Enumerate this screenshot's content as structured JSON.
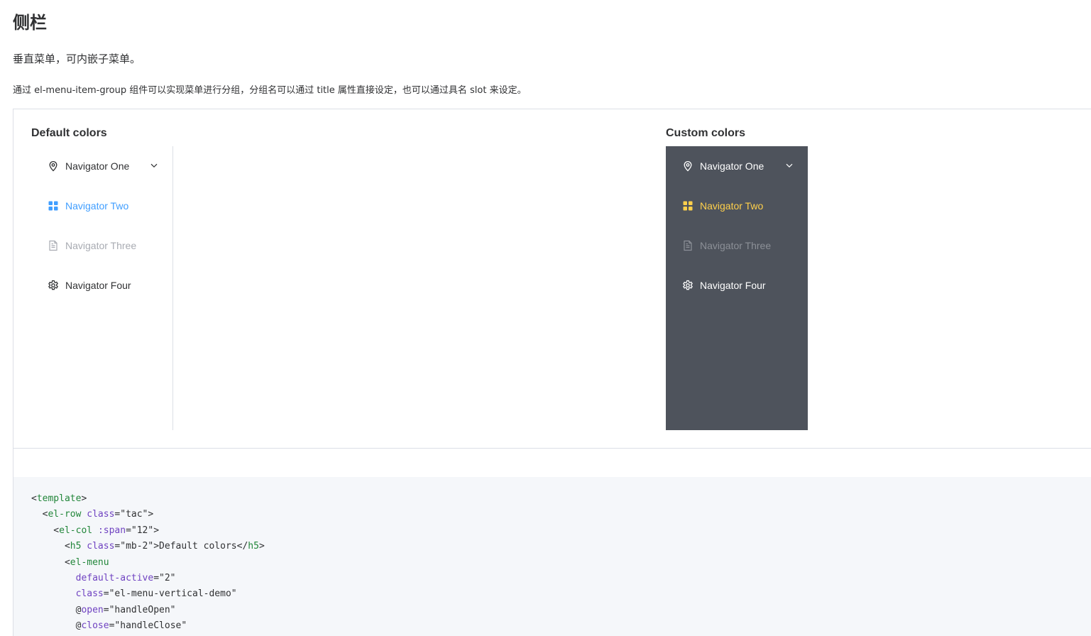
{
  "page": {
    "title": "侧栏",
    "intro": "垂直菜单，可内嵌子菜单。",
    "description": "通过 el-menu-item-group 组件可以实现菜单进行分组，分组名可以通过 title 属性直接设定，也可以通过具名 slot 来设定。"
  },
  "demo": {
    "default_title": "Default colors",
    "custom_title": "Custom colors",
    "default_menu": {
      "background": "#ffffff",
      "text_color": "#303133",
      "active_color": "#409eff",
      "disabled_color": "#a8abb2",
      "items": [
        {
          "label": "Navigator One",
          "icon": "location-icon",
          "has_submenu": true,
          "state": "normal"
        },
        {
          "label": "Navigator Two",
          "icon": "menu-grid-icon",
          "has_submenu": false,
          "state": "active"
        },
        {
          "label": "Navigator Three",
          "icon": "document-icon",
          "has_submenu": false,
          "state": "disabled"
        },
        {
          "label": "Navigator Four",
          "icon": "setting-icon",
          "has_submenu": false,
          "state": "normal"
        }
      ]
    },
    "custom_menu": {
      "background": "#545c64",
      "text_color": "#ffffff",
      "active_color": "#ffd04b",
      "disabled_color": "#8c9097",
      "items": [
        {
          "label": "Navigator One",
          "icon": "location-icon",
          "has_submenu": true,
          "state": "normal"
        },
        {
          "label": "Navigator Two",
          "icon": "menu-grid-icon",
          "has_submenu": false,
          "state": "active"
        },
        {
          "label": "Navigator Three",
          "icon": "document-icon",
          "has_submenu": false,
          "state": "disabled"
        },
        {
          "label": "Navigator Four",
          "icon": "setting-icon",
          "has_submenu": false,
          "state": "normal"
        }
      ]
    }
  },
  "code": {
    "lines": [
      [
        [
          "punct",
          "<"
        ],
        [
          "tag",
          "template"
        ],
        [
          "punct",
          ">"
        ]
      ],
      [
        [
          "punct",
          "  <"
        ],
        [
          "tag",
          "el-row"
        ],
        [
          "punct",
          " "
        ],
        [
          "attr",
          "class"
        ],
        [
          "punct",
          "="
        ],
        [
          "str",
          "\"tac\""
        ],
        [
          "punct",
          ">"
        ]
      ],
      [
        [
          "punct",
          "    <"
        ],
        [
          "tag",
          "el-col"
        ],
        [
          "punct",
          " "
        ],
        [
          "attr",
          ":span"
        ],
        [
          "punct",
          "="
        ],
        [
          "str",
          "\"12\""
        ],
        [
          "punct",
          ">"
        ]
      ],
      [
        [
          "punct",
          "      <"
        ],
        [
          "tag",
          "h5"
        ],
        [
          "punct",
          " "
        ],
        [
          "attr",
          "class"
        ],
        [
          "punct",
          "="
        ],
        [
          "str",
          "\"mb-2\""
        ],
        [
          "punct",
          ">Default colors</"
        ],
        [
          "tag",
          "h5"
        ],
        [
          "punct",
          ">"
        ]
      ],
      [
        [
          "punct",
          "      <"
        ],
        [
          "tag",
          "el-menu"
        ]
      ],
      [
        [
          "punct",
          "        "
        ],
        [
          "attr",
          "default-active"
        ],
        [
          "punct",
          "="
        ],
        [
          "str",
          "\"2\""
        ]
      ],
      [
        [
          "punct",
          "        "
        ],
        [
          "attr",
          "class"
        ],
        [
          "punct",
          "="
        ],
        [
          "str",
          "\"el-menu-vertical-demo\""
        ]
      ],
      [
        [
          "punct",
          "        @"
        ],
        [
          "attr",
          "open"
        ],
        [
          "punct",
          "="
        ],
        [
          "str",
          "\"handleOpen\""
        ]
      ],
      [
        [
          "punct",
          "        @"
        ],
        [
          "attr",
          "close"
        ],
        [
          "punct",
          "="
        ],
        [
          "str",
          "\"handleClose\""
        ]
      ]
    ]
  }
}
